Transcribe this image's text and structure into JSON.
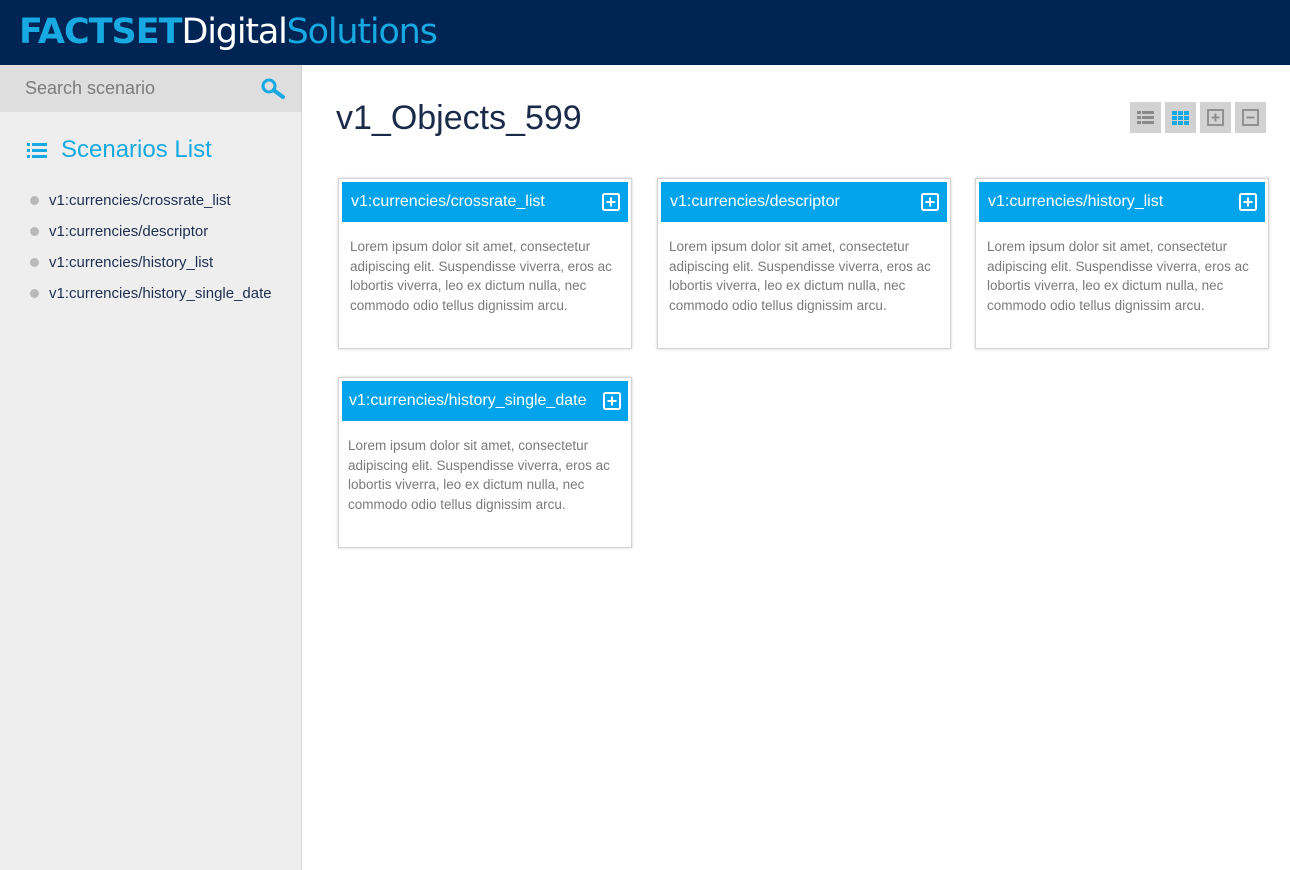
{
  "header": {
    "logo_part1": "FACTSET",
    "logo_part2": "Digital",
    "logo_part3": "Solutions"
  },
  "sidebar": {
    "search_placeholder": "Search scenario",
    "search_icon": "search-icon",
    "heading": "Scenarios List",
    "heading_icon": "list-icon",
    "items": [
      {
        "label": "v1:currencies/crossrate_list"
      },
      {
        "label": "v1:currencies/descriptor"
      },
      {
        "label": "v1:currencies/history_list"
      },
      {
        "label": "v1:currencies/history_single_date"
      }
    ]
  },
  "main": {
    "title": "v1_Objects_599",
    "view_controls": [
      {
        "name": "list-view",
        "icon": "list-view-icon"
      },
      {
        "name": "grid-view",
        "icon": "grid-view-icon"
      },
      {
        "name": "expand-all",
        "icon": "plus-square-icon"
      },
      {
        "name": "collapse-all",
        "icon": "minus-square-icon"
      }
    ],
    "cards": [
      {
        "title": "v1:currencies/crossrate_list",
        "body": "Lorem ipsum dolor sit amet, consectetur adipiscing elit. Suspendisse viverra, eros ac lobortis viverra, leo ex dictum nulla, nec commodo odio tellus dignissim arcu."
      },
      {
        "title": "v1:currencies/descriptor",
        "body": "Lorem ipsum dolor sit amet, consectetur adipiscing elit. Suspendisse viverra, eros ac lobortis viverra, leo ex dictum nulla, nec commodo odio tellus dignissim arcu."
      },
      {
        "title": "v1:currencies/history_list",
        "body": "Lorem ipsum dolor sit amet, consectetur adipiscing elit. Suspendisse viverra, eros ac lobortis viverra, leo ex dictum nulla, nec commodo odio tellus dignissim arcu."
      },
      {
        "title": "v1:currencies/history_single_date",
        "body": "Lorem ipsum dolor sit amet, consectetur adipiscing elit. Suspendisse viverra, eros ac lobortis viverra, leo ex dictum nulla, nec commodo odio tellus dignissim arcu."
      }
    ]
  },
  "colors": {
    "header_bg": "#002453",
    "accent": "#17a9e1",
    "card_header": "#03a4ec",
    "sidebar_bg": "#eeeeee"
  }
}
